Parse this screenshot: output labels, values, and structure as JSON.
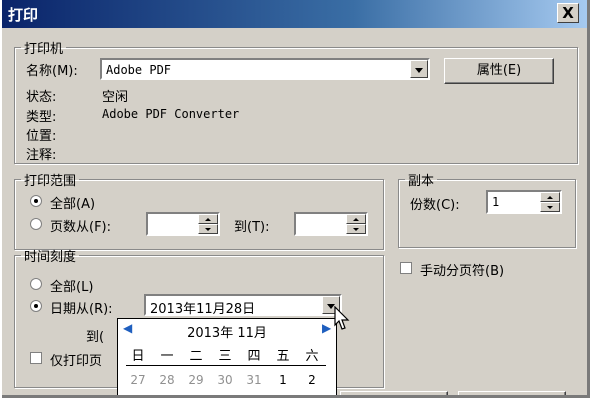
{
  "dialog": {
    "title": "打印",
    "close_label": "X"
  },
  "printer": {
    "legend": "打印机",
    "name_label": "名称(M):",
    "name_value": "Adobe PDF",
    "properties_button": "属性(E)",
    "status_label": "状态:",
    "status_value": "空闲",
    "type_label": "类型:",
    "type_value": "Adobe PDF Converter",
    "location_label": "位置:",
    "comment_label": "注释:"
  },
  "print_range": {
    "legend": "打印范围",
    "all_label": "全部(A)",
    "pages_from_label": "页数从(F):",
    "to_label": "到(T):",
    "selected": "all"
  },
  "copies": {
    "legend": "副本",
    "count_label": "份数(C):",
    "count_value": "1",
    "manual_duplex_label": "手动分页符(B)"
  },
  "timescale": {
    "legend": "时间刻度",
    "all_label": "全部(L)",
    "date_from_label": "日期从(R):",
    "date_from_value": "2013年11月28日",
    "to_label": "到(",
    "print_only_label": "仅打印页",
    "selected": "date"
  },
  "calendar": {
    "month_label": "2013年  11月",
    "prev_icon": "◀",
    "next_icon": "▶",
    "weekdays": [
      "日",
      "一",
      "二",
      "三",
      "四",
      "五",
      "六"
    ],
    "first_row": [
      "27",
      "28",
      "29",
      "30",
      "31",
      "1",
      "2"
    ]
  }
}
